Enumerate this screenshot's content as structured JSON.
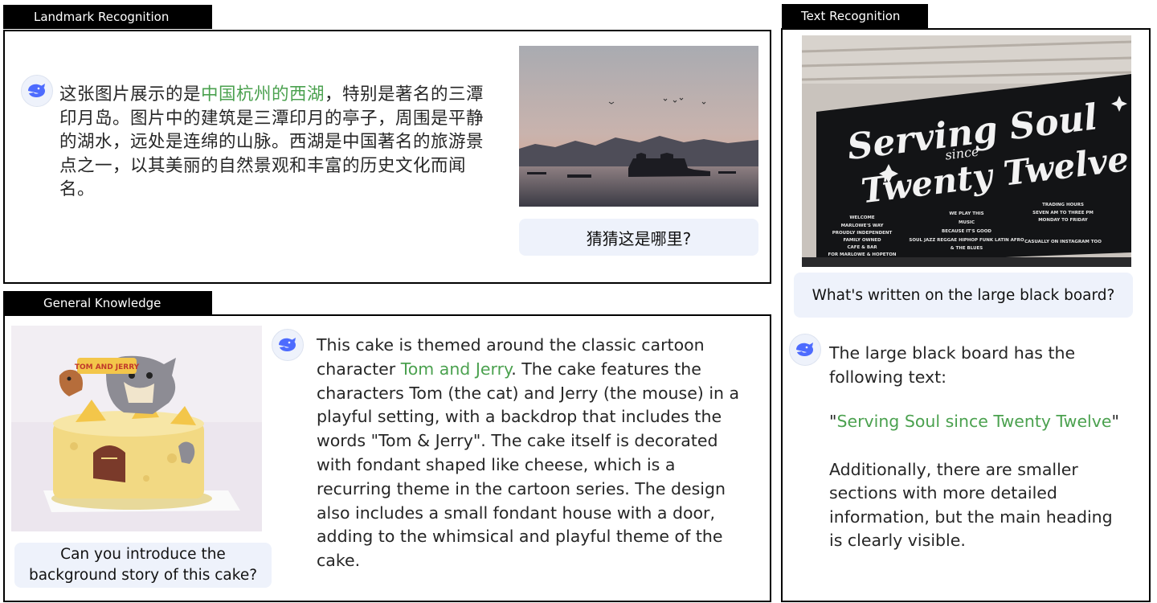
{
  "landmark": {
    "tab": "Landmark Recognition",
    "question": "猜猜这是哪里?",
    "answer_before": "这张图片展示的是",
    "answer_highlight": "中国杭州的西湖",
    "answer_after": "，特别是著名的三潭印月岛。图片中的建筑是三潭印月的亭子，周围是平静的湖水，远处是连绵的山脉。西湖是中国著名的旅游景点之一，以其美丽的自然景观和丰富的历史文化而闻名。"
  },
  "general": {
    "tab": "General Knowledge",
    "question": "Can you introduce the background story of this cake?",
    "answer_before": "This cake is themed around the classic cartoon character ",
    "answer_highlight": "Tom and Jerry",
    "answer_after": ". The cake features the characters Tom (the cat) and Jerry (the mouse) in a playful setting, with a backdrop that includes the words \"Tom & Jerry\". The cake itself is decorated with fondant shaped like cheese, which is a recurring theme in the cartoon series. The design also includes a small fondant house with a door, adding to the whimsical and playful theme of the cake."
  },
  "text": {
    "tab": "Text Recognition",
    "question": "What's written on the large black board?",
    "answer_intro": "The large black board has the following text:",
    "quote_open": "\"",
    "quote_highlight": "Serving Soul since Twenty Twelve",
    "quote_close": "\"",
    "answer_after": "Additionally, there are smaller sections with more detailed information, but the main heading is clearly visible."
  },
  "sign": {
    "line1": "Serving Soul",
    "line2": "since",
    "line3": "Twenty Twelve",
    "col1": [
      "WELCOME",
      "MARLOWE'S WAY",
      "PROUDLY INDEPENDENT",
      "FAMILY OWNED",
      "CAFE & BAR",
      "FOR MARLOWE & HOPETON"
    ],
    "col2": [
      "WE PLAY THIS",
      "MUSIC",
      "BECAUSE IT'S GOOD",
      "SOUL JAZZ REGGAE HIPHOP FUNK LATIN AFRO",
      "& THE BLUES"
    ],
    "col3": [
      "TRADING HOURS",
      "SEVEN AM TO THREE PM",
      "MONDAY TO FRIDAY",
      "CASUALLY ON INSTAGRAM TOO"
    ]
  },
  "cake": {
    "label": "TOM AND JERRY"
  },
  "colors": {
    "highlight": "#4ba14f",
    "bubble": "#eef2fb",
    "tab": "#000000"
  },
  "icons": {
    "assistant": "whale-logo-icon"
  }
}
